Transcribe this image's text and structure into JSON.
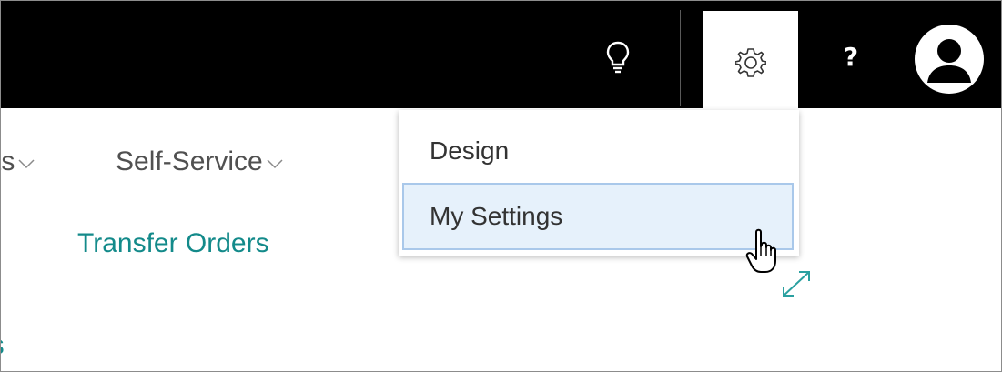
{
  "header": {
    "tools": [
      {
        "name": "lightbulb-icon"
      },
      {
        "name": "gear-icon"
      },
      {
        "name": "help-icon",
        "label": "?"
      },
      {
        "name": "avatar-icon"
      }
    ]
  },
  "nav": {
    "items": [
      {
        "label": "ts"
      },
      {
        "label": "Self-Service"
      }
    ]
  },
  "links": {
    "transfer_orders": "Transfer Orders",
    "partial": "ls"
  },
  "settings_menu": {
    "items": [
      {
        "label": "Design"
      },
      {
        "label": "My Settings",
        "hovered": true
      }
    ]
  },
  "colors": {
    "topbar": "#000000",
    "link": "#138a8a",
    "hover_bg": "#e6f1fb",
    "hover_border": "#a9c8ea"
  }
}
